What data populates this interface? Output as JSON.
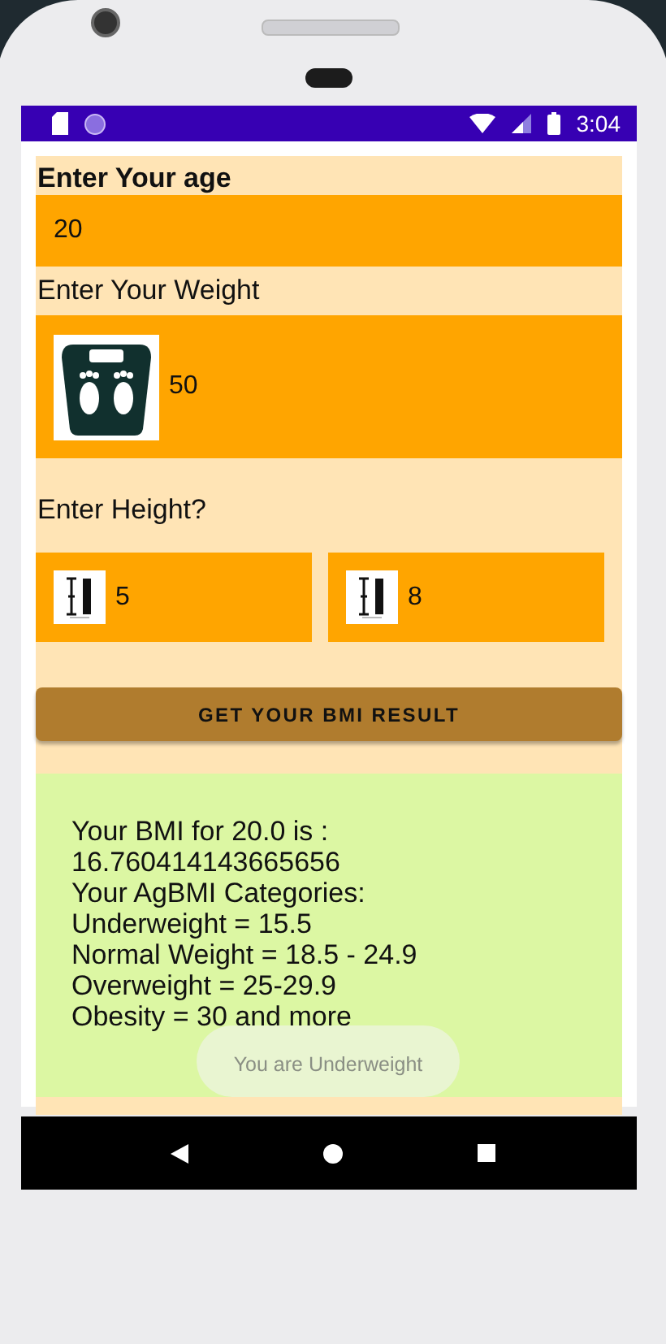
{
  "status_bar": {
    "time": "3:04"
  },
  "age": {
    "label": "Enter Your age",
    "value": "20"
  },
  "weight": {
    "label": "Enter Your Weight",
    "value": "50"
  },
  "height": {
    "label": "Enter Height?",
    "feet": "5",
    "inches": "8"
  },
  "button": {
    "label": "GET YOUR BMI RESULT"
  },
  "result": {
    "lines": [
      "Your BMI for 20.0 is :",
      "16.760414143665656",
      "Your AgBMI Categories:",
      "Underweight = 15.5",
      "Normal Weight = 18.5 - 24.9",
      "Overweight = 25-29.9",
      "Obesity = 30 and more"
    ]
  },
  "toast": {
    "text": "You are Underweight"
  }
}
